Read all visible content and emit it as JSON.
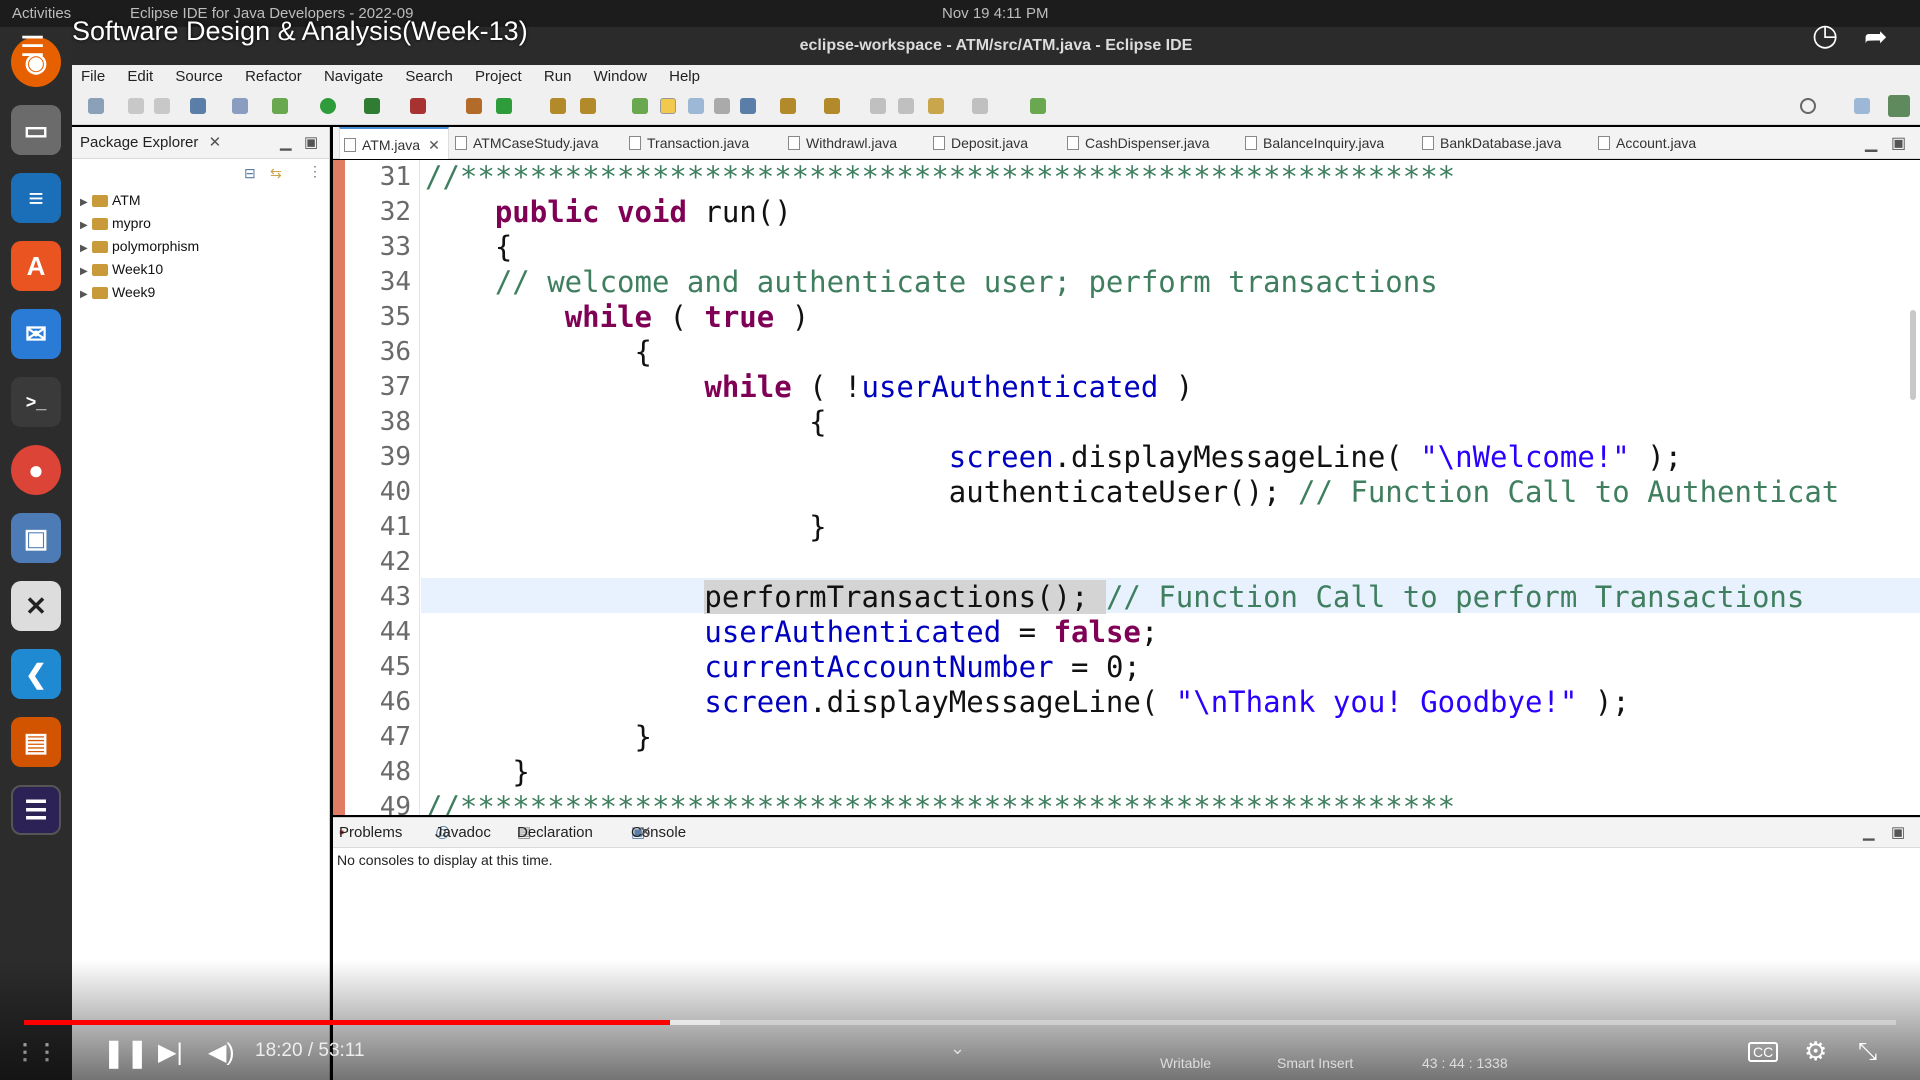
{
  "topbar": {
    "activities": "Activities",
    "app": "Eclipse IDE for Java Developers - 2022-09",
    "clock": "Nov 19  4:11 PM"
  },
  "video": {
    "title": "Software Design & Analysis(Week-13)",
    "time": "18:20 / 53:11",
    "progress": 0.345
  },
  "window": {
    "title": "eclipse-workspace - ATM/src/ATM.java - Eclipse IDE"
  },
  "menu": [
    "File",
    "Edit",
    "Source",
    "Refactor",
    "Navigate",
    "Search",
    "Project",
    "Run",
    "Window",
    "Help"
  ],
  "package_explorer": {
    "title": "Package Explorer",
    "items": [
      "ATM",
      "mypro",
      "polymorphism",
      "Week10",
      "Week9"
    ]
  },
  "editor_tabs": [
    "ATM.java",
    "ATMCaseStudy.java",
    "Transaction.java",
    "Withdrawl.java",
    "Deposit.java",
    "CashDispenser.java",
    "BalanceInquiry.java",
    "BankDatabase.java",
    "Account.java"
  ],
  "lines": [
    "31",
    "32",
    "33",
    "34",
    "35",
    "36",
    "37",
    "38",
    "39",
    "40",
    "41",
    "42",
    "43",
    "44",
    "45",
    "46",
    "47",
    "48",
    "49"
  ],
  "code": {
    "l31": "//*********************************************************",
    "l32_kw": "public void",
    "l32_rest": " run()",
    "l33": "{",
    "l34": "// welcome and authenticate user; perform transactions",
    "l35_kw1": "while",
    "l35_mid": " ( ",
    "l35_kw2": "true",
    "l35_end": " )",
    "l36": "{",
    "l37_kw": "while",
    "l37_a": " ( !",
    "l37_fd": "userAuthenticated",
    "l37_b": " )",
    "l38": "{",
    "l39_fd": "screen",
    "l39_a": ".displayMessageLine( ",
    "l39_st": "\"\\nWelcome!\"",
    "l39_b": " );",
    "l40_a": "authenticateUser(); ",
    "l40_cm": "// Function Call to Authenticat",
    "l41": "}",
    "l43_a": "performTransactions(); ",
    "l43_cm": "// Function Call to perform Transactions",
    "l44_fd": "userAuthenticated",
    "l44_a": " = ",
    "l44_kw": "false",
    "l44_b": ";",
    "l45_fd": "currentAccountNumber",
    "l45_a": " = 0;",
    "l46_fd": "screen",
    "l46_a": ".displayMessageLine( ",
    "l46_st": "\"\\nThank you! Goodbye!\"",
    "l46_b": " );",
    "l47": "}",
    "l48": "}",
    "l49": "//*********************************************************"
  },
  "bottom_tabs": [
    "Problems",
    "Javadoc",
    "Declaration",
    "Console"
  ],
  "console_msg": "No consoles to display at this time.",
  "status": {
    "writable": "Writable",
    "insert": "Smart Insert",
    "position": "43 : 44 : 1338"
  }
}
